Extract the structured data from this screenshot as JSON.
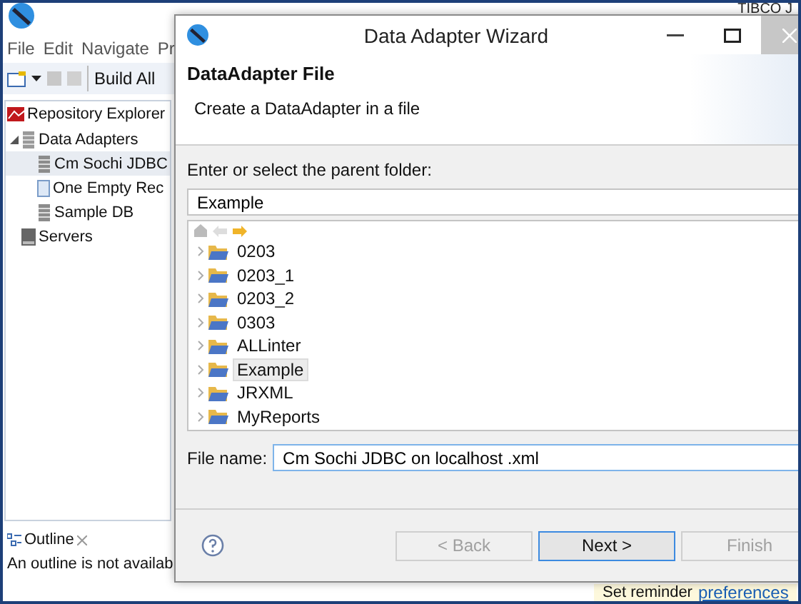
{
  "main_window": {
    "title": "TIBCO J"
  },
  "menu": [
    "File",
    "Edit",
    "Navigate",
    "Pr"
  ],
  "toolbar": {
    "build_label": "Build All"
  },
  "repository": {
    "tab": "Repository Explorer",
    "tree": [
      {
        "label": "Data Adapters",
        "kind": "folder",
        "expanded": true,
        "children": [
          {
            "label": "Cm Sochi JDBC",
            "kind": "db",
            "selected": true
          },
          {
            "label": "One Empty Rec",
            "kind": "empty",
            "selected": false
          },
          {
            "label": "Sample DB",
            "kind": "db",
            "selected": false
          }
        ]
      },
      {
        "label": "Servers",
        "kind": "server"
      }
    ]
  },
  "outline": {
    "tab": "Outline",
    "message": "An outline is not availab"
  },
  "status": {
    "text": "Set reminder",
    "link": "preferences"
  },
  "dialog": {
    "title": "Data Adapter Wizard",
    "heading": "DataAdapter File",
    "description": "Create a DataAdapter in a file",
    "folder_label": "Enter or select the parent folder:",
    "folder_value": "Example",
    "folders": [
      {
        "label": "0203",
        "selected": false
      },
      {
        "label": "0203_1",
        "selected": false
      },
      {
        "label": "0203_2",
        "selected": false
      },
      {
        "label": "0303",
        "selected": false
      },
      {
        "label": "ALLinter",
        "selected": false
      },
      {
        "label": "Example",
        "selected": true
      },
      {
        "label": "JRXML",
        "selected": false
      },
      {
        "label": "MyReports",
        "selected": false
      }
    ],
    "file_label": "File name:",
    "file_value": "Cm Sochi JDBC on localhost .xml",
    "buttons": [
      {
        "label": "< Back",
        "disabled": true,
        "default": false
      },
      {
        "label": "Next >",
        "disabled": false,
        "default": true
      },
      {
        "label": "Finish",
        "disabled": true,
        "default": false
      }
    ]
  }
}
